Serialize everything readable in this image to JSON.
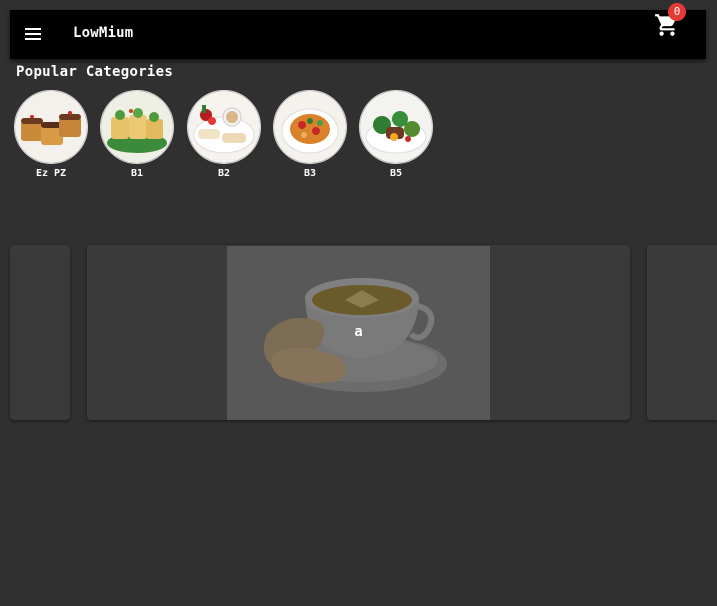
{
  "app_bar": {
    "title": "LowMium",
    "menu_icon": "menu-icon",
    "cart_icon": "shopping-cart-icon",
    "cart_count": "0"
  },
  "categories": {
    "title": "Popular Categories",
    "items": [
      {
        "label": "Ez PZ"
      },
      {
        "label": "B1"
      },
      {
        "label": "B2"
      },
      {
        "label": "B3"
      },
      {
        "label": "B5"
      }
    ]
  },
  "carousel": {
    "current_caption": "a"
  },
  "colors": {
    "background": "#303030",
    "app_bar": "#000000",
    "badge": "#e53935",
    "card": "#3a3a3a"
  }
}
